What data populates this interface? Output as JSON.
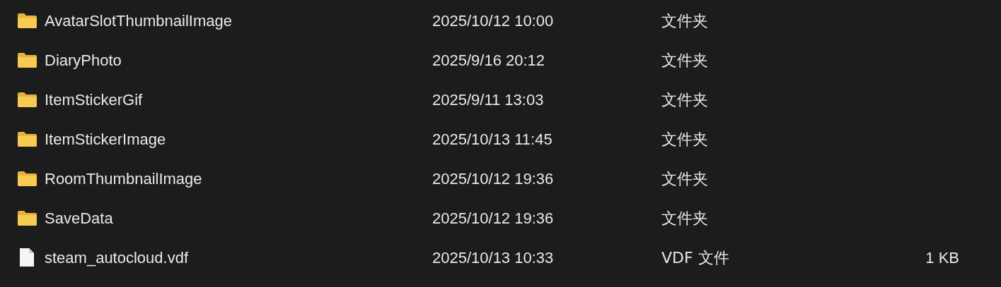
{
  "files": [
    {
      "kind": "folder",
      "name": "AvatarSlotThumbnailImage",
      "modified": "2025/10/12 10:00",
      "type": "文件夹"
    },
    {
      "kind": "folder",
      "name": "DiaryPhoto",
      "modified": "2025/9/16 20:12",
      "type": "文件夹"
    },
    {
      "kind": "folder",
      "name": "ItemStickerGif",
      "modified": "2025/9/11 13:03",
      "type": "文件夹"
    },
    {
      "kind": "folder",
      "name": "ItemStickerImage",
      "modified": "2025/10/13 11:45",
      "type": "文件夹"
    },
    {
      "kind": "folder",
      "name": "RoomThumbnailImage",
      "modified": "2025/10/12 19:36",
      "type": "文件夹"
    },
    {
      "kind": "folder",
      "name": "SaveData",
      "modified": "2025/10/12 19:36",
      "type": "文件夹"
    },
    {
      "kind": "file",
      "name": "steam_autocloud.vdf",
      "modified": "2025/10/13 10:33",
      "type": "VDF 文件",
      "size": "1 KB"
    }
  ]
}
